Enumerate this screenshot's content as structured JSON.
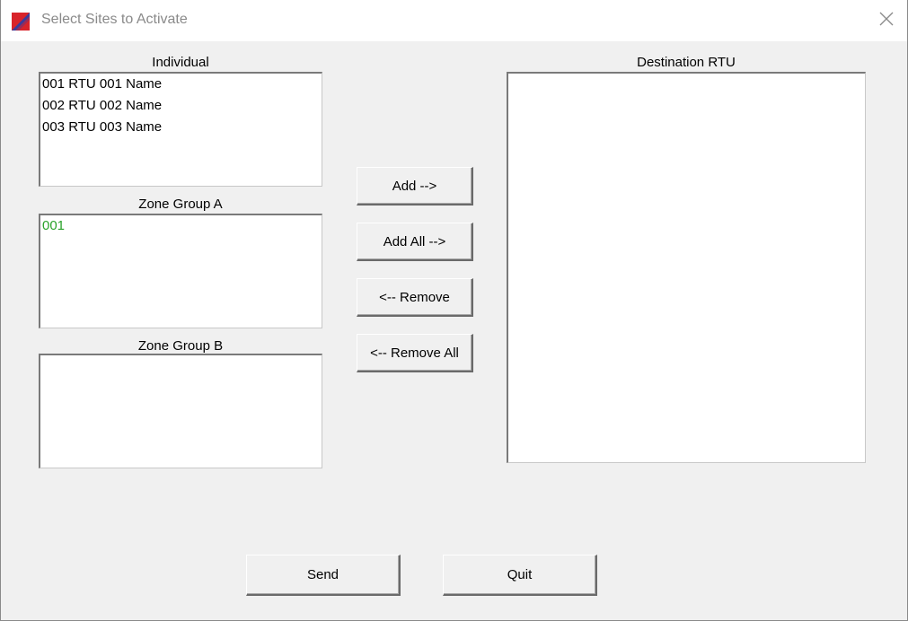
{
  "window": {
    "title": "Select Sites to Activate"
  },
  "individual": {
    "label": "Individual",
    "items": [
      "001 RTU 001 Name",
      "002 RTU 002 Name",
      "003 RTU 003 Name"
    ]
  },
  "zone_group_a": {
    "label": "Zone Group A",
    "items": [
      "001"
    ],
    "item_color": "#2aa22a"
  },
  "zone_group_b": {
    "label": "Zone Group B",
    "items": []
  },
  "destination": {
    "label": "Destination RTU",
    "items": []
  },
  "actions": {
    "add_label": "Add -->",
    "add_all_label": "Add All -->",
    "remove_label": "<-- Remove",
    "remove_all_label": "<-- Remove All"
  },
  "footer": {
    "send_label": "Send",
    "quit_label": "Quit"
  },
  "icons": {
    "app": "app-logo-icon",
    "close": "close-icon"
  }
}
